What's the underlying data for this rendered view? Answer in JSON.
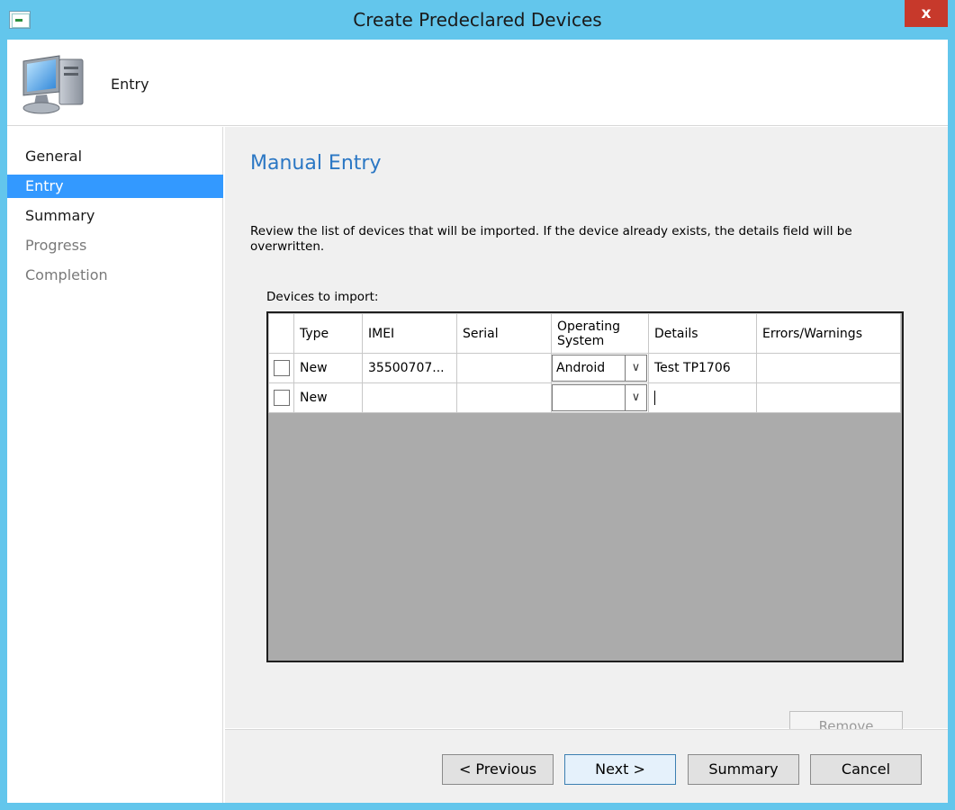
{
  "window": {
    "title": "Create Predeclared Devices",
    "close_label": "x"
  },
  "banner": {
    "title": "Entry"
  },
  "sidebar": {
    "items": [
      {
        "label": "General",
        "state": "normal"
      },
      {
        "label": "Entry",
        "state": "active"
      },
      {
        "label": "Summary",
        "state": "normal"
      },
      {
        "label": "Progress",
        "state": "disabled"
      },
      {
        "label": "Completion",
        "state": "disabled"
      }
    ]
  },
  "main": {
    "title": "Manual Entry",
    "description": "Review the list of devices that will be imported.  If the device already exists, the details field will be overwritten.",
    "list_label": "Devices to import:",
    "columns": {
      "type": "Type",
      "imei": "IMEI",
      "serial": "Serial",
      "os_line1": "Operating",
      "os_line2": "System",
      "details": "Details",
      "errors": "Errors/Warnings"
    },
    "rows": [
      {
        "checked": false,
        "type": "New",
        "imei": "35500707...",
        "serial": "",
        "os": "Android",
        "details": "Test TP1706",
        "errors": ""
      },
      {
        "checked": false,
        "type": "New",
        "imei": "",
        "serial": "",
        "os": "",
        "details": "",
        "errors": ""
      }
    ],
    "remove_label": "Remove"
  },
  "footer": {
    "previous_label": "< Previous",
    "next_label": "Next >",
    "summary_label": "Summary",
    "cancel_label": "Cancel"
  },
  "colors": {
    "window_border": "#63c6ec",
    "accent": "#3399ff",
    "title_blue": "#2b77c4",
    "close_red": "#c7392b"
  }
}
